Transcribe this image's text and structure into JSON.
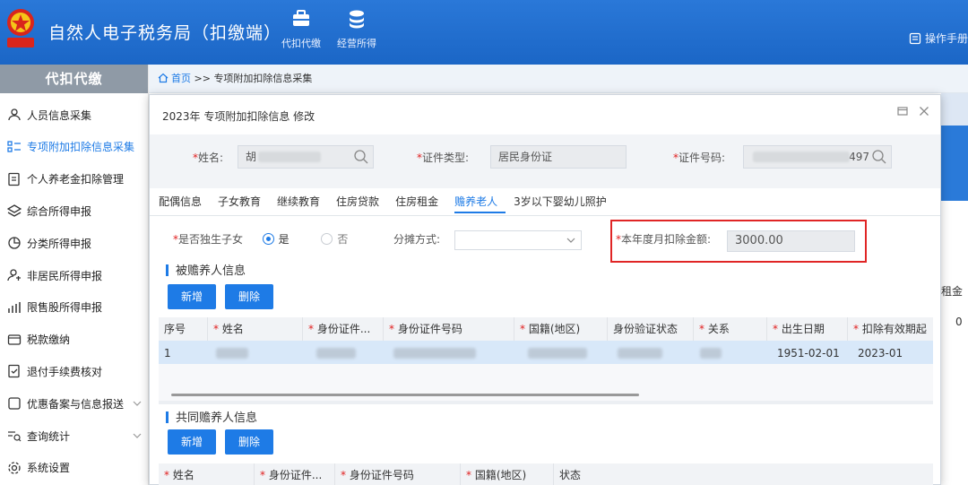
{
  "header": {
    "app_title": "自然人电子税务局（扣缴端）",
    "emblem_text": "中国税务",
    "nav": [
      {
        "label": "代扣代缴",
        "icon": "briefcase-icon"
      },
      {
        "label": "经营所得",
        "icon": "coin-stack-icon"
      }
    ],
    "ops_label": "操作手册"
  },
  "sidebar": {
    "title": "代扣代缴",
    "items": [
      {
        "label": "人员信息采集",
        "icon": "person-icon",
        "active": false
      },
      {
        "label": "专项附加扣除信息采集",
        "icon": "list-icon",
        "active": true
      },
      {
        "label": "个人养老金扣除管理",
        "icon": "pension-icon",
        "active": false
      },
      {
        "label": "综合所得申报",
        "icon": "layers-icon",
        "active": false
      },
      {
        "label": "分类所得申报",
        "icon": "pie-icon",
        "active": false
      },
      {
        "label": "非居民所得申报",
        "icon": "foreign-person-icon",
        "active": false
      },
      {
        "label": "限售股所得申报",
        "icon": "bar-icon",
        "active": false
      },
      {
        "label": "税款缴纳",
        "icon": "wallet-icon",
        "active": false
      },
      {
        "label": "退付手续费核对",
        "icon": "doc-check-icon",
        "active": false
      },
      {
        "label": "优惠备案与信息报送",
        "icon": "folder-icon",
        "active": false,
        "expandable": true
      },
      {
        "label": "查询统计",
        "icon": "query-icon",
        "active": false,
        "expandable": true
      },
      {
        "label": "系统设置",
        "icon": "gear-icon",
        "active": false
      }
    ]
  },
  "breadcrumb": {
    "home": "首页",
    "sep": ">>",
    "current": "专项附加扣除信息采集"
  },
  "background": {
    "col_header_fragment": "租金",
    "cell_fragment": "0"
  },
  "modal": {
    "title": "2023年 专项附加扣除信息 修改",
    "fields": {
      "name_label": "姓名:",
      "name_value": "胡",
      "id_type_label": "证件类型:",
      "id_type_value": "居民身份证",
      "id_number_label": "证件号码:",
      "id_number_value": "497"
    },
    "tabs": [
      "配偶信息",
      "子女教育",
      "继续教育",
      "住房贷款",
      "住房租金",
      "赡养老人",
      "3岁以下婴幼儿照护"
    ],
    "active_tab": 5,
    "only_child_label": "是否独生子女",
    "only_child_yes": "是",
    "only_child_no": "否",
    "only_child_selected": "是",
    "split_label": "分摊方式:",
    "split_value": "",
    "monthly_amount_label": "本年度月扣除金额:",
    "monthly_amount_value": "3000.00",
    "supported_section": {
      "title": "被赡养人信息",
      "add_label": "新增",
      "delete_label": "删除",
      "columns": [
        "序号",
        "姓名",
        "身份证件...",
        "身份证件号码",
        "国籍(地区)",
        "身份验证状态",
        "关系",
        "出生日期",
        "扣除有效期起"
      ],
      "required_columns": [
        false,
        true,
        true,
        true,
        true,
        false,
        true,
        true,
        true
      ],
      "rows": [
        {
          "index": "1",
          "name": "",
          "id_type": "",
          "id_number": "",
          "nationality": "",
          "verify_status": "",
          "relation": "",
          "birth_date": "1951-02-01",
          "deduct_start": "2023-01"
        }
      ]
    },
    "co_supporter_section": {
      "title": "共同赡养人信息",
      "add_label": "新增",
      "delete_label": "删除",
      "columns": [
        "姓名",
        "身份证件...",
        "身份证件号码",
        "国籍(地区)",
        "状态"
      ],
      "required_columns": [
        true,
        true,
        true,
        true,
        false
      ]
    }
  },
  "colors": {
    "header_blue": "#1f6fd0",
    "accent_blue": "#1e7be6",
    "highlight_red": "#e02525",
    "sidebar_head_gray": "#8f9aa6"
  }
}
